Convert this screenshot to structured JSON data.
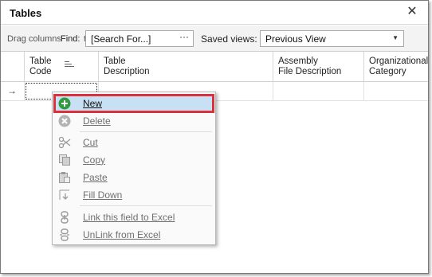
{
  "window": {
    "title": "Tables",
    "close_glyph": "✕"
  },
  "toolbar": {
    "drag_hint": "Drag columns here t",
    "find_label": "Find:",
    "find_value": "[Search For...]",
    "find_button": "···",
    "saved_views_label": "Saved views:",
    "saved_views_value": "Previous View",
    "dropdown_glyph": "▼"
  },
  "grid": {
    "columns": [
      {
        "line1": "Table",
        "line2": "Code"
      },
      {
        "line1": "Table",
        "line2": "Description"
      },
      {
        "line1": "Assembly",
        "line2": "File Description"
      },
      {
        "line1": "Organizational",
        "line2": "Category"
      }
    ],
    "row_indicator": "→"
  },
  "context_menu": {
    "items": [
      {
        "label": "New",
        "icon": "plus-icon",
        "state": "selected"
      },
      {
        "label": "Delete",
        "icon": "delete-icon",
        "state": "disabled"
      },
      {
        "label": "Cut",
        "icon": "scissors-icon",
        "state": "disabled"
      },
      {
        "label": "Copy",
        "icon": "copy-icon",
        "state": "disabled"
      },
      {
        "label": "Paste",
        "icon": "paste-icon",
        "state": "disabled"
      },
      {
        "label": "Fill Down",
        "icon": "fill-down-icon",
        "state": "disabled"
      },
      {
        "label": "Link this field to Excel",
        "icon": "link-excel-icon",
        "state": "disabled"
      },
      {
        "label": "UnLink from Excel",
        "icon": "unlink-excel-icon",
        "state": "disabled"
      }
    ]
  },
  "colors": {
    "highlight": "#c7e0f4",
    "highlight_border": "#d9323c",
    "new_icon": "#2e9b3c"
  }
}
